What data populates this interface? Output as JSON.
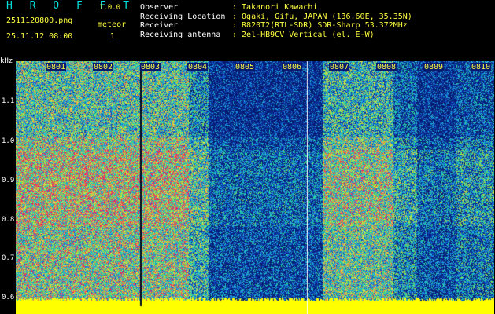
{
  "header": {
    "app_title": "H R O F F T",
    "app_version": "1.0.0",
    "file_name": "2511120800.png",
    "meteor_label": "meteor",
    "date_time": "25.11.12 08:00",
    "meteor_count": "1"
  },
  "info": [
    {
      "key": "Observer",
      "value": ": Takanori Kawachi"
    },
    {
      "key": "Receiving Location",
      "value": ": Ogaki, Gifu, JAPAN (136.60E, 35.35N)"
    },
    {
      "key": "Receiver",
      "value": ": R820T2(RTL-SDR) SDR-Sharp 53.372MHz"
    },
    {
      "key": "Receiving antenna",
      "value": ": 2el-HB9CV Vertical (el. E-W)"
    }
  ],
  "plot": {
    "unit_label": "kHz",
    "y_ticks": [
      "1.1",
      "1.0",
      "0.9",
      "0.8",
      "0.7",
      "0.6"
    ],
    "x_ticks": [
      "0801",
      "0802",
      "0803",
      "0804",
      "0805",
      "0806",
      "0807",
      "0808",
      "0809",
      "0810"
    ]
  },
  "colors": {
    "background": "#000000",
    "title": "#00e0e0",
    "label_yellow": "#ffff40",
    "noise_floor": "#ffff00"
  }
}
